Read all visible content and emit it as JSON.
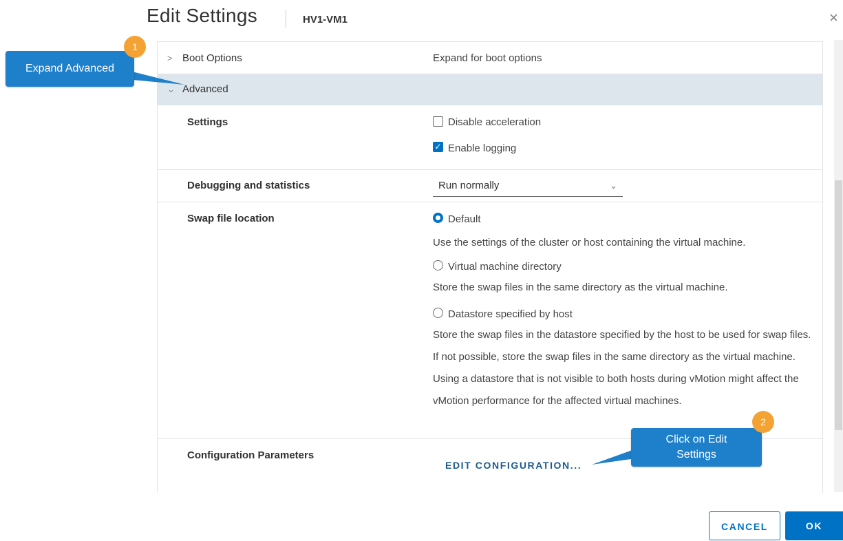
{
  "dialog": {
    "title": "Edit Settings",
    "vm_name": "HV1-VM1",
    "close_icon": "×"
  },
  "boot_options": {
    "label": "Boot Options",
    "value": "Expand for boot options"
  },
  "advanced": {
    "label": "Advanced",
    "settings": {
      "label": "Settings",
      "disable_acceleration": {
        "label": "Disable acceleration",
        "checked": false
      },
      "enable_logging": {
        "label": "Enable logging",
        "checked": true
      }
    },
    "debugging": {
      "label": "Debugging and statistics",
      "selected": "Run normally"
    },
    "swap_file": {
      "label": "Swap file location",
      "options": [
        {
          "label": "Default",
          "selected": true,
          "description": "Use the settings of the cluster or host containing the virtual machine."
        },
        {
          "label": "Virtual machine directory",
          "selected": false,
          "description": "Store the swap files in the same directory as the virtual machine."
        },
        {
          "label": "Datastore specified by host",
          "selected": false,
          "description": "Store the swap files in the datastore specified by the host to be used for swap files. If not possible, store the swap files in the same directory as the virtual machine. Using a datastore that is not visible to both hosts during vMotion might affect the vMotion performance for the affected virtual machines."
        }
      ]
    },
    "config_params": {
      "label": "Configuration Parameters",
      "link": "EDIT CONFIGURATION..."
    }
  },
  "buttons": {
    "cancel": "CANCEL",
    "ok": "OK"
  },
  "callouts": [
    {
      "number": "1",
      "text": "Expand Advanced"
    },
    {
      "number": "2",
      "text": "Click on Edit Settings"
    }
  ],
  "colors": {
    "accent": "#0072c6",
    "callout": "#1e7fcb",
    "badge": "#f4a234",
    "advanced_row_bg": "#dde6ec"
  }
}
